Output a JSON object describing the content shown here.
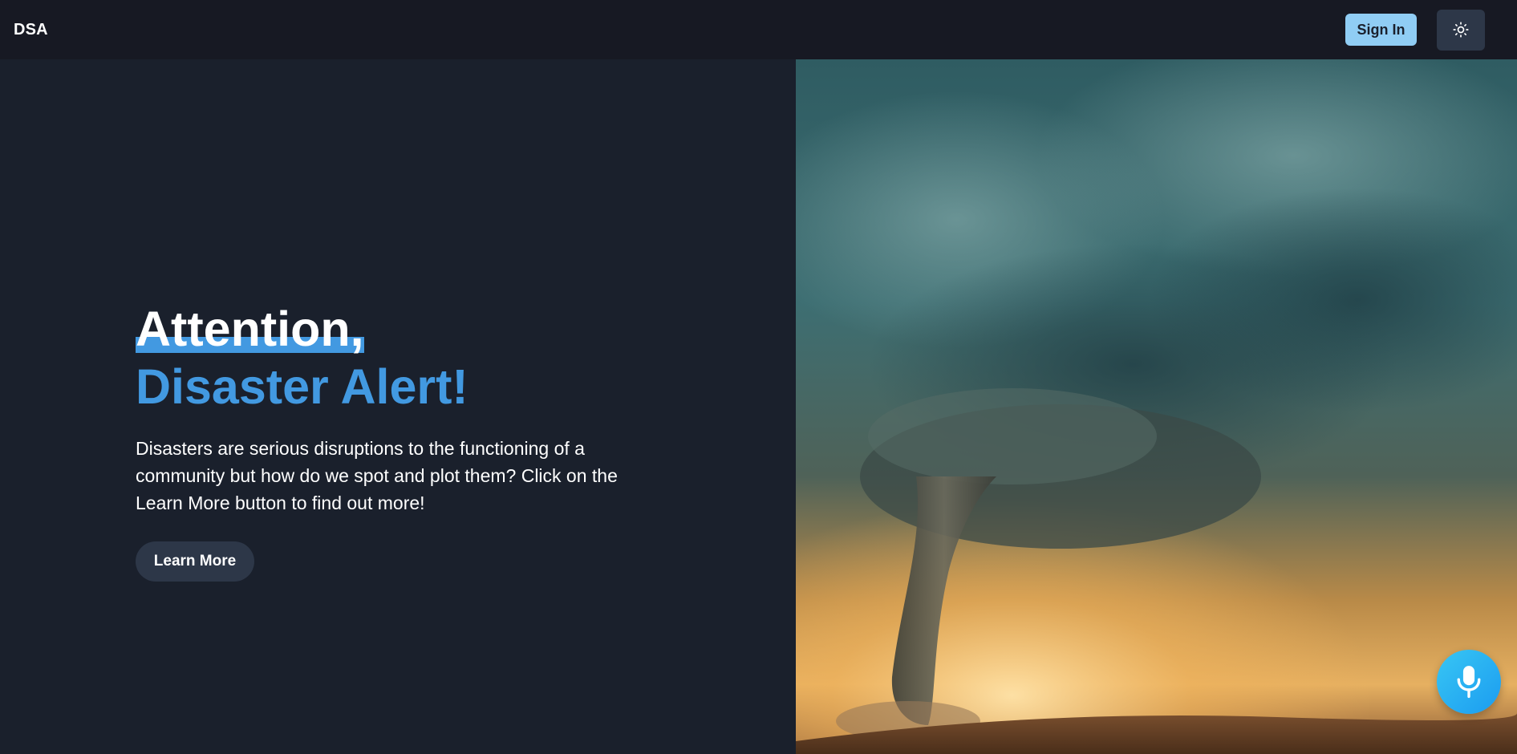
{
  "navbar": {
    "brand": "DSA",
    "signin_label": "Sign In",
    "theme_toggle_icon": "sun-icon"
  },
  "hero": {
    "title_line1": "Attention,",
    "title_line2": "Disaster Alert!",
    "description": "Disasters are serious disruptions to the functioning of a community but how do we spot and plot them? Click on the Learn More button to find out more!",
    "learn_more_label": "Learn More",
    "image": "tornado-storm-photo"
  },
  "voice": {
    "icon": "microphone-icon"
  },
  "colors": {
    "background": "#1a202c",
    "navbar": "#171923",
    "accent": "#4299e1",
    "signin_bg": "#90cdf4",
    "button_dark": "#2d3748",
    "mic_gradient_start": "#38c6f4",
    "mic_gradient_end": "#1b9cf0"
  }
}
